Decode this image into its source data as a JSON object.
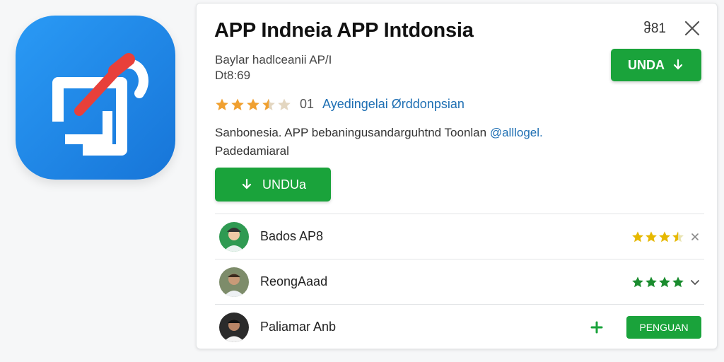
{
  "app": {
    "title": "APP Indneia APP Intdonsia",
    "counter": "ჵ81",
    "publisher": "Baylar hadlceanii AP/I",
    "size": "Dt8:69",
    "download_top_label": "UNDA",
    "rating": {
      "value": 3.5,
      "max": 5,
      "text": "01",
      "link": "Ayedingelai Ørddonpsian"
    },
    "description": {
      "text": "Sanbonesia. APP bebaningusandarguhtnd Toonlan",
      "mention": "@alllogel.",
      "line2": "Padedamiaral"
    },
    "download_main_label": "UNDUa"
  },
  "reviews": [
    {
      "name": "Bados AP8",
      "stars": 3.5,
      "star_color": "#e6b800",
      "action_icon": "close-icon"
    },
    {
      "name": "ReongAaad",
      "stars": 4,
      "star_color": "#1a8c2e",
      "action_icon": "chevron-down-icon"
    },
    {
      "name": "Paliamar Anb",
      "action_icon": "plus-icon",
      "button_label": "PENGUAN"
    }
  ],
  "colors": {
    "accent_green": "#1aa33b",
    "link_blue": "#1e6fb3",
    "star_orange": "#f0a030",
    "icon_blue": "#1f87e8",
    "icon_red": "#e8403a"
  }
}
